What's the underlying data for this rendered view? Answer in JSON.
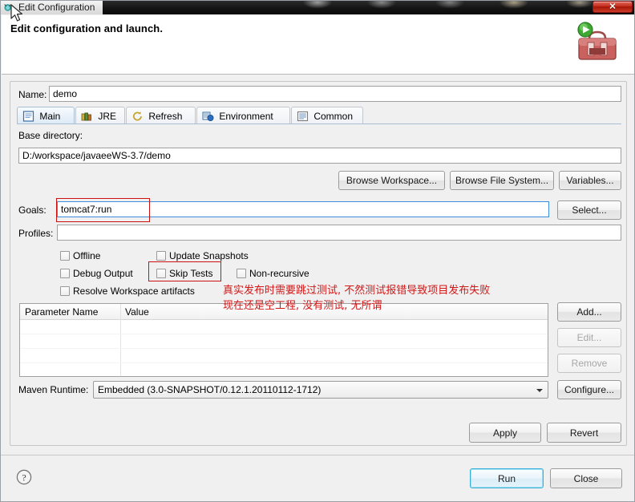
{
  "window": {
    "title": "Edit Configuration",
    "app_icon": "debug-configuration-icon",
    "close_label": "✕"
  },
  "header": {
    "title": "Edit configuration and launch.",
    "icon": "maven-toolbox-launch-icon"
  },
  "form": {
    "name_label": "Name:",
    "name_value": "demo",
    "base_directory_label": "Base directory:",
    "base_directory_value": "D:/workspace/javaeeWS-3.7/demo",
    "goals_label": "Goals:",
    "goals_value": "tomcat7:run",
    "profiles_label": "Profiles:",
    "profiles_value": ""
  },
  "tabs": [
    {
      "label": "Main",
      "icon": "main-page-icon",
      "active": true
    },
    {
      "label": "JRE",
      "icon": "jre-books-icon",
      "active": false
    },
    {
      "label": "Refresh",
      "icon": "refresh-icon",
      "active": false
    },
    {
      "label": "Environment",
      "icon": "environment-icon",
      "active": false
    },
    {
      "label": "Common",
      "icon": "common-list-icon",
      "active": false
    }
  ],
  "dir_buttons": [
    {
      "label": "Browse Workspace...",
      "name": "browse-workspace-button"
    },
    {
      "label": "Browse File System...",
      "name": "browse-file-system-button"
    },
    {
      "label": "Variables...",
      "name": "variables-button"
    }
  ],
  "goals_select_label": "Select...",
  "checkboxes": [
    {
      "label": "Offline",
      "checked": false,
      "name": "checkbox-offline"
    },
    {
      "label": "Update Snapshots",
      "checked": false,
      "name": "checkbox-update-snapshots"
    },
    {
      "label": "Debug Output",
      "checked": false,
      "name": "checkbox-debug-output"
    },
    {
      "label": "Skip Tests",
      "checked": false,
      "name": "checkbox-skip-tests"
    },
    {
      "label": "Non-recursive",
      "checked": false,
      "name": "checkbox-non-recursive"
    },
    {
      "label": "Resolve Workspace artifacts",
      "checked": false,
      "name": "checkbox-resolve-workspace-artifacts"
    }
  ],
  "parameters_table": {
    "columns": [
      "Parameter Name",
      "Value"
    ],
    "rows": []
  },
  "table_buttons": [
    {
      "label": "Add...",
      "enabled": true,
      "name": "add-parameter-button"
    },
    {
      "label": "Edit...",
      "enabled": false,
      "name": "edit-parameter-button"
    },
    {
      "label": "Remove",
      "enabled": false,
      "name": "remove-parameter-button"
    }
  ],
  "maven_runtime": {
    "label": "Maven Runtime:",
    "value": "Embedded (3.0-SNAPSHOT/0.12.1.20110112-1712)",
    "configure_label": "Configure..."
  },
  "panel_buttons": [
    {
      "label": "Apply",
      "name": "apply-button"
    },
    {
      "label": "Revert",
      "name": "revert-button"
    }
  ],
  "dialog_buttons": [
    {
      "label": "Run",
      "name": "run-button",
      "default": true
    },
    {
      "label": "Close",
      "name": "close-button",
      "default": false
    }
  ],
  "help_icon": "help-question-icon",
  "annotations": {
    "line1": "真实发布时需要跳过测试, 不然测试报错导致项目发布失败",
    "line2": "现在还是空工程, 没有测试, 无所谓",
    "color": "#d31616"
  },
  "colors": {
    "accent": "#3c8dde",
    "annotation": "#cc1111",
    "dialog_bg": "#f0f0f0",
    "close_button": "#c42d1c"
  }
}
